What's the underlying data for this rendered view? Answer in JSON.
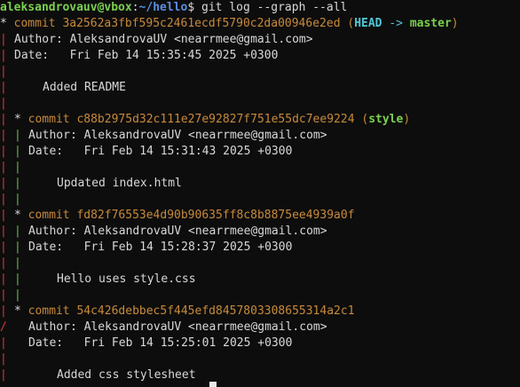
{
  "prompt": {
    "user_host": "aleksandrovauv@vbox",
    "sep": ":",
    "path": "~/hello",
    "dollar": "$",
    "command": " git log --graph --all"
  },
  "commits": [
    {
      "star": "*",
      "label": "commit",
      "hash": "3a2562a3fbf595c2461ecdf5790c2da00946e2ed",
      "refs_open": " (",
      "head": "HEAD",
      "arrow": " -> ",
      "branch": "master",
      "refs_close": ")",
      "author": "Author: AleksandrovaUV <nearrmee@gmail.com>",
      "date": "Date:   Fri Feb 14 15:35:45 2025 +0300",
      "message": "Added README"
    },
    {
      "star": "*",
      "label": "commit",
      "hash": "c88b2975d32c111e27e92827f751e55dc7ee9224",
      "refs_open": " (",
      "branch": "style",
      "refs_close": ")",
      "author": "Author: AleksandrovaUV <nearrmee@gmail.com>",
      "date": "Date:   Fri Feb 14 15:31:43 2025 +0300",
      "message": "Updated index.html"
    },
    {
      "star": "*",
      "label": "commit",
      "hash": "fd82f76553e4d90b90635ff8c8b8875ee4939a0f",
      "author": "Author: AleksandrovaUV <nearrmee@gmail.com>",
      "date": "Date:   Fri Feb 14 15:28:37 2025 +0300",
      "message": "Hello uses style.css"
    },
    {
      "star": "*",
      "label": "commit",
      "hash": "54c426debbec5f445efd8457803308655314a2c1",
      "author": "Author: AleksandrovaUV <nearrmee@gmail.com>",
      "date": "Date:   Fri Feb 14 15:25:01 2025 +0300",
      "message": "Added css stylesheet"
    }
  ],
  "graph": {
    "bar": "|",
    "merge": "/"
  },
  "colors": {
    "background": "#0d0d0d",
    "text": "#d8d8d8",
    "commit": "#c88a3a",
    "graph_red": "#d13a3a",
    "graph_green": "#5fbf4a",
    "prompt_user": "#7ad04e",
    "prompt_path": "#5b8fe0",
    "head": "#4fc7d6"
  }
}
